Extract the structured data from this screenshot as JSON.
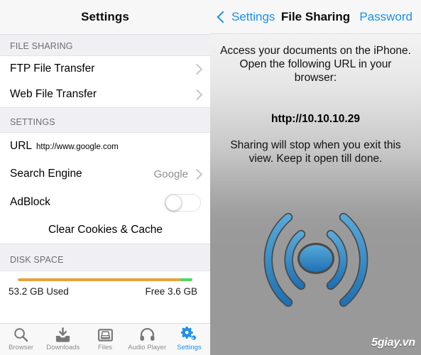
{
  "left_panel": {
    "nav_title": "Settings",
    "sections": [
      {
        "header": "FILE SHARING",
        "rows": [
          {
            "label": "FTP File Transfer",
            "accessory": "chevron"
          },
          {
            "label": "Web File Transfer",
            "accessory": "chevron"
          }
        ]
      },
      {
        "header": "SETTINGS",
        "rows": [
          {
            "label": "URL",
            "sub": "http://www.google.com"
          },
          {
            "label": "Search Engine",
            "value": "Google",
            "accessory": "chevron"
          },
          {
            "label": "AdBlock",
            "toggle": "off"
          },
          {
            "label": "Clear Cookies & Cache"
          }
        ]
      },
      {
        "header": "DISK SPACE",
        "disk": {
          "used_label": "53.2 GB Used",
          "free_label": "Free 3.6 GB",
          "used_percent": 93,
          "free_percent": 7,
          "used_color": "#e8a33d",
          "free_color": "#4cd964"
        }
      }
    ],
    "tabbar": [
      {
        "label": "Browser",
        "icon": "magnifier-icon",
        "active": false
      },
      {
        "label": "Downloads",
        "icon": "download-tray-icon",
        "active": false
      },
      {
        "label": "Files",
        "icon": "files-tray-icon",
        "active": false
      },
      {
        "label": "Audio Player",
        "icon": "headphones-icon",
        "active": false
      },
      {
        "label": "Settings",
        "icon": "gear-icon",
        "active": true
      }
    ]
  },
  "right_panel": {
    "back_label": "Settings",
    "title": "File Sharing",
    "password_label": "Password",
    "intro_text": "Access your documents on the iPhone. Open the following URL in your browser:",
    "url": "http://10.10.10.29",
    "note_text": "Sharing will stop when you exit this view. Keep it open till done.",
    "icon": "wifi-broadcast-icon",
    "watermark": "5giay.vn"
  },
  "colors": {
    "accent": "#1e8fe8",
    "group_header_bg": "#efeff4",
    "group_header_text": "#6d6d72",
    "wifi_blue_light": "#4a9fd4",
    "wifi_blue_dark": "#2176b8"
  }
}
